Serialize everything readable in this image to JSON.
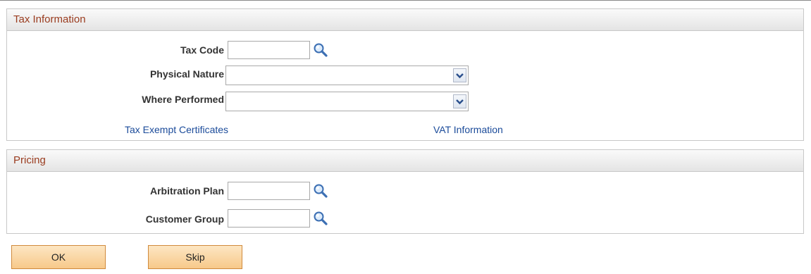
{
  "tax_information": {
    "header": "Tax Information",
    "tax_code": {
      "label": "Tax Code",
      "value": ""
    },
    "physical_nature": {
      "label": "Physical Nature",
      "selected": ""
    },
    "where_performed": {
      "label": "Where Performed",
      "selected": ""
    },
    "links": {
      "tax_exempt_certificates": "Tax Exempt Certificates",
      "vat_information": "VAT Information"
    }
  },
  "pricing": {
    "header": "Pricing",
    "arbitration_plan": {
      "label": "Arbitration Plan",
      "value": ""
    },
    "customer_group": {
      "label": "Customer Group",
      "value": ""
    }
  },
  "buttons": {
    "ok": "OK",
    "skip": "Skip"
  },
  "icons": {
    "lookup": "magnifier-icon",
    "dropdown": "chevron-down-icon"
  },
  "colors": {
    "section_header_text": "#9a3c1f",
    "link": "#1b4b9a",
    "button_fill": "#f7c98a"
  }
}
